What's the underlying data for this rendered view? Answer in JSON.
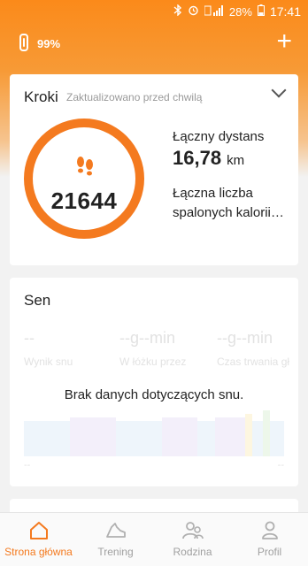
{
  "status": {
    "battery": "28%",
    "time": "17:41"
  },
  "appbar": {
    "band_battery": "99%"
  },
  "steps": {
    "title": "Kroki",
    "subtitle": "Zaktualizowano przed chwilą",
    "count": "21644",
    "distance_label": "Łączny dystans",
    "distance_value": "16,78",
    "distance_unit": "km",
    "calories_label": "Łączna liczba spalonych kalorii…"
  },
  "sleep": {
    "title": "Sen",
    "no_data": "Brak danych dotyczących snu.",
    "ghost_values": [
      "--",
      "--g--min",
      "--g--min"
    ],
    "ghost_labels": [
      "Wynik snu",
      "W łóżku przez",
      "Czas trwania gł"
    ],
    "axis_left": "--",
    "axis_right": "--"
  },
  "nav": {
    "items": [
      {
        "label": "Strona główna",
        "icon": "home-icon"
      },
      {
        "label": "Trening",
        "icon": "shoe-icon"
      },
      {
        "label": "Rodzina",
        "icon": "family-icon"
      },
      {
        "label": "Profil",
        "icon": "profile-icon"
      }
    ]
  },
  "colors": {
    "accent": "#f47a1f",
    "header": "#fb8a1a"
  }
}
